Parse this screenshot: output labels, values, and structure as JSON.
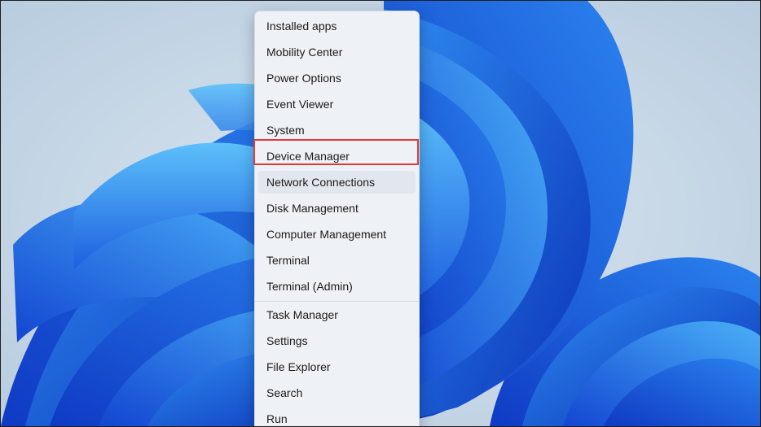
{
  "desktop": {
    "wallpaper": "windows-11-bloom",
    "colors": {
      "background": "#c4d6e6",
      "bloom_dark": "#0a2fb5",
      "bloom_mid": "#1a5fe3",
      "bloom_light": "#3aa0f5",
      "highlight": "#e5383b"
    }
  },
  "power_user_menu": {
    "items": [
      {
        "label": "Installed apps"
      },
      {
        "label": "Mobility Center"
      },
      {
        "label": "Power Options"
      },
      {
        "label": "Event Viewer"
      },
      {
        "label": "System"
      },
      {
        "label": "Device Manager",
        "highlighted": true
      },
      {
        "label": "Network Connections",
        "hovered": true
      },
      {
        "label": "Disk Management"
      },
      {
        "label": "Computer Management"
      },
      {
        "label": "Terminal"
      },
      {
        "label": "Terminal (Admin)"
      },
      {
        "label": "Task Manager"
      },
      {
        "label": "Settings"
      },
      {
        "label": "File Explorer"
      },
      {
        "label": "Search"
      },
      {
        "label": "Run"
      }
    ]
  }
}
